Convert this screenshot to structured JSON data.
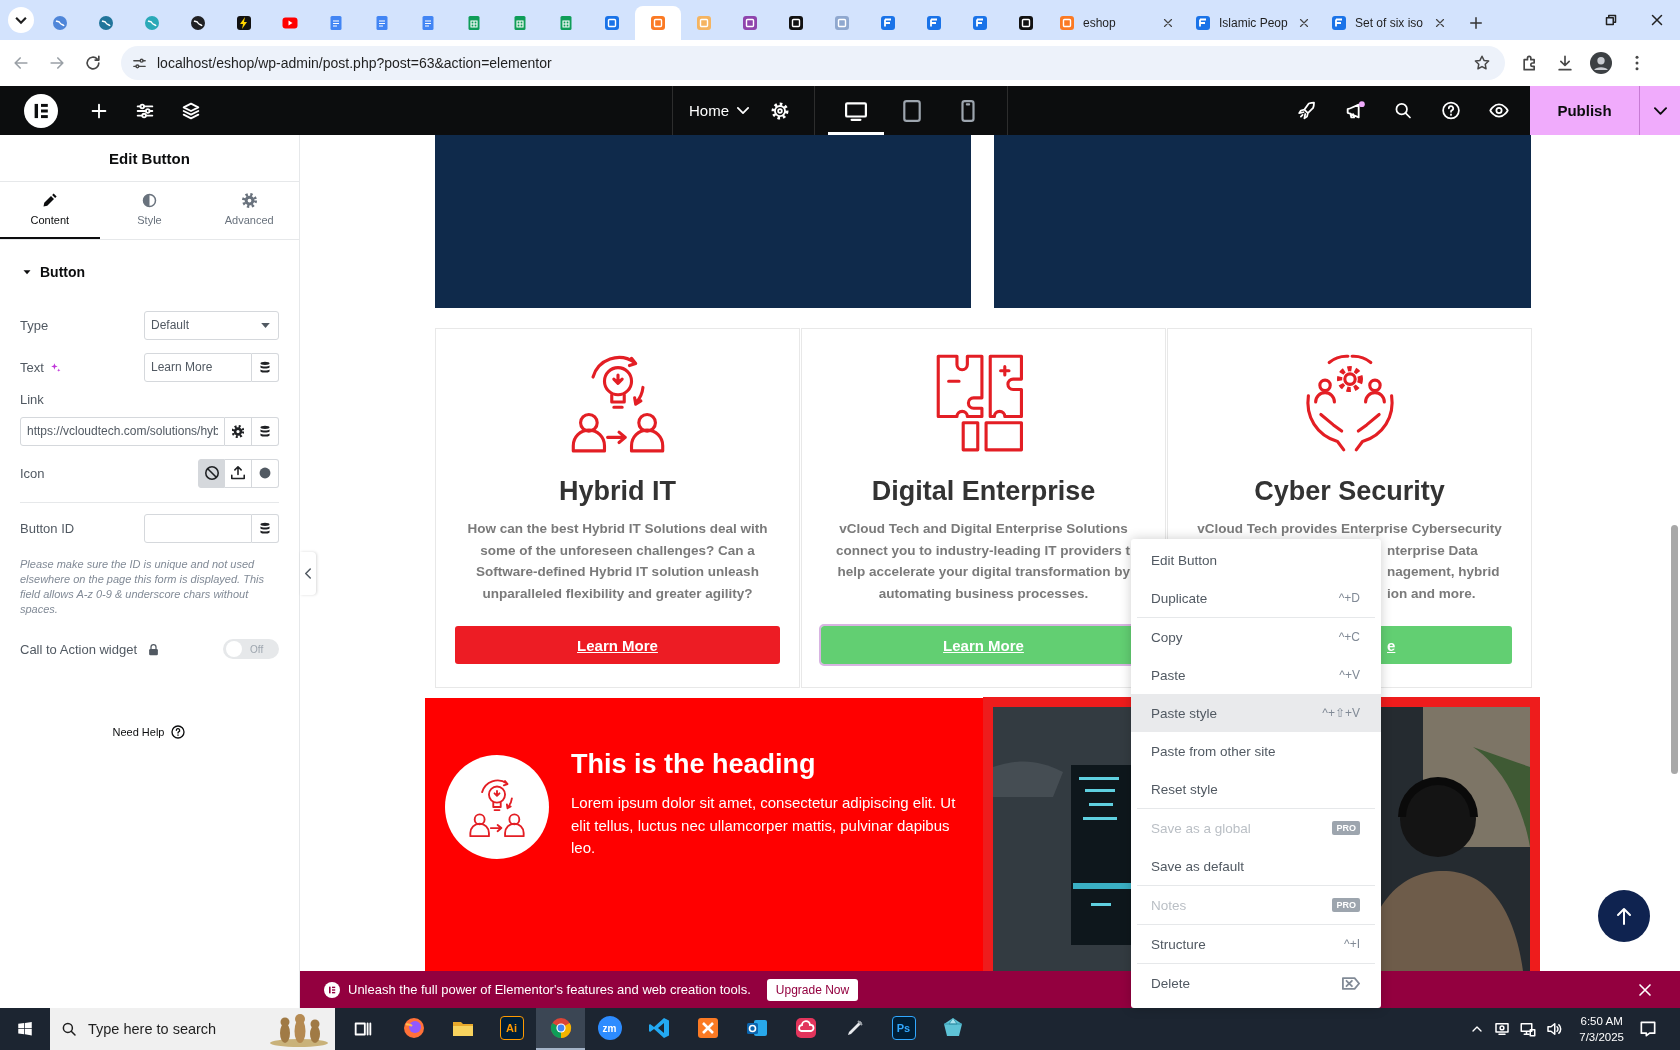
{
  "browser": {
    "tabs": [
      {
        "kind": "icon",
        "color": "#4f86d9",
        "selected": false
      },
      {
        "kind": "icon",
        "color": "#21759b",
        "selected": false
      },
      {
        "kind": "icon",
        "color": "#2aa9b8",
        "selected": false
      },
      {
        "kind": "icon",
        "color": "#202124",
        "selected": false
      },
      {
        "kind": "icon",
        "color": "#111111",
        "selected": false
      },
      {
        "kind": "icon",
        "color": "#ff0000",
        "selected": false
      },
      {
        "kind": "icon",
        "color": "#4285f4",
        "selected": false
      },
      {
        "kind": "icon",
        "color": "#4285f4",
        "selected": false
      },
      {
        "kind": "icon",
        "color": "#4285f4",
        "selected": false
      },
      {
        "kind": "icon",
        "color": "#0f9d58",
        "selected": false
      },
      {
        "kind": "icon",
        "color": "#0f9d58",
        "selected": false
      },
      {
        "kind": "icon",
        "color": "#0f9d58",
        "selected": false
      },
      {
        "kind": "icon",
        "color": "#1a73e8",
        "selected": false
      },
      {
        "kind": "icon",
        "color": "#fb7a24",
        "selected": true
      },
      {
        "kind": "icon",
        "color": "#f5b461",
        "selected": false
      },
      {
        "kind": "icon",
        "color": "#8e44ad",
        "selected": false
      },
      {
        "kind": "icon",
        "color": "#111111",
        "selected": false
      },
      {
        "kind": "icon",
        "color": "#8fa8cf",
        "selected": false
      },
      {
        "kind": "icon",
        "color": "#1a73e8",
        "selected": false
      },
      {
        "kind": "icon",
        "color": "#1a73e8",
        "selected": false
      },
      {
        "kind": "icon",
        "color": "#1a73e8",
        "selected": false
      },
      {
        "kind": "icon",
        "color": "#111111",
        "selected": false
      },
      {
        "kind": "titled",
        "color": "#fb7a24",
        "title": "eshop",
        "selected": false
      },
      {
        "kind": "titled",
        "color": "#1a73e8",
        "title": "Islamic Peop",
        "selected": false
      },
      {
        "kind": "titled",
        "color": "#1a73e8",
        "title": "Set of six iso",
        "selected": false
      }
    ],
    "url": "localhost/eshop/wp-admin/post.php?post=63&action=elementor"
  },
  "editor_bar": {
    "page": "Home",
    "devices": [
      {
        "kind": "desktop",
        "selected": true
      },
      {
        "kind": "tablet",
        "selected": false
      },
      {
        "kind": "mobile",
        "selected": false
      }
    ],
    "notification": true,
    "publish": "Publish"
  },
  "panel": {
    "title": "Edit Button",
    "tabs": [
      {
        "kind": "content",
        "label": "Content",
        "selected": true
      },
      {
        "kind": "style",
        "label": "Style",
        "selected": false
      },
      {
        "kind": "advanced",
        "label": "Advanced",
        "selected": false
      }
    ],
    "section": {
      "title": "Button",
      "expanded": true
    },
    "type": {
      "label": "Type",
      "value": "Default"
    },
    "text": {
      "label": "Text",
      "value": "Learn More"
    },
    "link": {
      "label": "Link",
      "value": "https://vcloudtech.com/solutions/hyb"
    },
    "icon": {
      "label": "Icon",
      "options": [
        {
          "kind": "none",
          "selected": true
        },
        {
          "kind": "upload",
          "selected": false
        },
        {
          "kind": "circle",
          "selected": false
        }
      ]
    },
    "button_id": {
      "label": "Button ID"
    },
    "help": "Please make sure the ID is unique and not used elsewhere on the page this form is displayed. This field allows A-z 0-9 & underscore chars without spaces.",
    "cta": {
      "label": "Call to Action widget",
      "on": false,
      "toggle_text": "Off"
    },
    "need_help": "Need Help"
  },
  "canvas": {
    "cards": [
      {
        "title": "Hybrid IT",
        "lines": [
          {
            "kind": "full",
            "text": "How can the best Hybrid IT Solutions deal with"
          },
          {
            "kind": "full",
            "text": "some of the unforeseen challenges? Can a"
          },
          {
            "kind": "full",
            "text": "Software-defined Hybrid IT solution unleash"
          },
          {
            "kind": "full",
            "text": "unparalleled flexibility and greater agility?"
          }
        ],
        "button": {
          "label": "Learn More",
          "kind": "full",
          "color": "#ed1c24",
          "selected": false
        }
      },
      {
        "title": "Digital Enterprise",
        "lines": [
          {
            "kind": "full",
            "text": "vCloud Tech and Digital Enterprise Solutions"
          },
          {
            "kind": "clip-end",
            "text": "connect you to industry-leading IT providers t"
          },
          {
            "kind": "clip-end",
            "text": "help accelerate your digital transformation by"
          },
          {
            "kind": "full",
            "text": "automating business processes."
          }
        ],
        "button": {
          "label": "Learn More",
          "kind": "full",
          "color": "#62cf72",
          "selected": true
        }
      },
      {
        "title": "Cyber Security",
        "lines": [
          {
            "kind": "full",
            "text": "vCloud Tech provides Enterprise Cybersecurity"
          },
          {
            "kind": "clip-start",
            "text": "nterprise Data"
          },
          {
            "kind": "clip-start",
            "text": "nagement, hybrid"
          },
          {
            "kind": "clip-start",
            "text": "ion and more."
          }
        ],
        "button": {
          "label": "e",
          "kind": "clip-start",
          "color": "#62cf72",
          "selected": false
        }
      }
    ],
    "feature": {
      "heading": "This is the heading",
      "text": "Lorem ipsum dolor sit amet, consectetur adipiscing elit. Ut elit tellus, luctus nec ullamcorper mattis, pulvinar dapibus leo."
    }
  },
  "context_menu": {
    "items": [
      {
        "kind": "plain",
        "label": "Edit Button",
        "divider_above": false,
        "disabled": false,
        "highlighted": false
      },
      {
        "kind": "shortcut",
        "label": "Duplicate",
        "shortcut": "^+D",
        "divider_above": false,
        "disabled": false,
        "highlighted": false
      },
      {
        "kind": "shortcut",
        "label": "Copy",
        "shortcut": "^+C",
        "divider_above": true,
        "disabled": false,
        "highlighted": false
      },
      {
        "kind": "shortcut",
        "label": "Paste",
        "shortcut": "^+V",
        "divider_above": false,
        "disabled": false,
        "highlighted": false
      },
      {
        "kind": "shortcut",
        "label": "Paste style",
        "shortcut": "^+⇧+V",
        "divider_above": false,
        "disabled": false,
        "highlighted": true
      },
      {
        "kind": "plain",
        "label": "Paste from other site",
        "divider_above": false,
        "disabled": false,
        "highlighted": false
      },
      {
        "kind": "plain",
        "label": "Reset style",
        "divider_above": false,
        "disabled": false,
        "highlighted": false
      },
      {
        "kind": "pro",
        "label": "Save as a global",
        "badge": "PRO",
        "divider_above": true,
        "disabled": true,
        "highlighted": false
      },
      {
        "kind": "plain",
        "label": "Save as default",
        "divider_above": false,
        "disabled": false,
        "highlighted": false
      },
      {
        "kind": "pro",
        "label": "Notes",
        "badge": "PRO",
        "divider_above": true,
        "disabled": true,
        "highlighted": false
      },
      {
        "kind": "shortcut",
        "label": "Structure",
        "shortcut": "^+I",
        "divider_above": true,
        "disabled": false,
        "highlighted": false
      },
      {
        "kind": "key",
        "label": "Delete",
        "divider_above": true,
        "disabled": false,
        "highlighted": false
      }
    ]
  },
  "promo": {
    "text": "Unleash the full power of Elementor's features and web creation tools.",
    "button": "Upgrade Now"
  },
  "taskbar": {
    "placeholder": "Type here to search",
    "apps": [
      {
        "kind": "firefox",
        "selected": false
      },
      {
        "kind": "folder",
        "selected": false
      },
      {
        "kind": "tile",
        "label": "Ai",
        "color": "#ff9a00",
        "selected": false
      },
      {
        "kind": "chrome",
        "selected": true
      },
      {
        "kind": "round",
        "label": "zm",
        "color": "#2d8cff",
        "selected": false
      },
      {
        "kind": "code",
        "selected": false
      },
      {
        "kind": "xampp",
        "selected": false
      },
      {
        "kind": "mail",
        "selected": false
      },
      {
        "kind": "cloud",
        "selected": false
      },
      {
        "kind": "pen",
        "selected": false
      },
      {
        "kind": "tile",
        "label": "Ps",
        "color": "#31a8ff",
        "selected": false
      },
      {
        "kind": "gem",
        "selected": false
      }
    ],
    "time": "6:50 AM",
    "date": "7/3/2025"
  }
}
